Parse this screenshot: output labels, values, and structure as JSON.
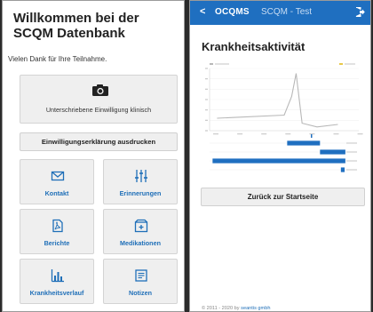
{
  "left_screen": {
    "title": "Willkommen bei der SCQM Datenbank",
    "subtitle": "Vielen Dank für Ihre Teilnahme.",
    "signed_consent_label": "Unterschriebene Einwilligung klinisch",
    "print_button": "Einwilligungserklärung ausdrucken",
    "tiles": [
      {
        "label": "Kontakt",
        "icon": "envelope-icon"
      },
      {
        "label": "Erinnerungen",
        "icon": "sliders-icon"
      },
      {
        "label": "Berichte",
        "icon": "pdf-icon"
      },
      {
        "label": "Medikationen",
        "icon": "medication-box-icon"
      },
      {
        "label": "Krankheitsverlauf",
        "icon": "bar-chart-icon"
      },
      {
        "label": "Notizen",
        "icon": "notes-icon"
      }
    ]
  },
  "right_screen": {
    "topbar": {
      "back": "<",
      "brand": "OCQMS",
      "app_name": "SCQM - Test",
      "color": "#1f6fc0"
    },
    "title": "Krankheitsaktivität",
    "back_button": "Zurück zur Startseite",
    "footer": {
      "copyright": "© 2011 - 2020 by",
      "company": "seantis gmbh"
    }
  },
  "chart_data": {
    "type": "line",
    "series_colors": [
      "#b8b8b8",
      "#e8c84a"
    ],
    "line_points": [
      [
        0.05,
        0.2
      ],
      [
        0.5,
        0.25
      ],
      [
        0.55,
        0.55
      ],
      [
        0.58,
        0.92
      ],
      [
        0.62,
        0.12
      ],
      [
        0.72,
        0.06
      ],
      [
        0.86,
        0.1
      ]
    ],
    "bar_color": "#1f6fc0",
    "grid": true
  }
}
